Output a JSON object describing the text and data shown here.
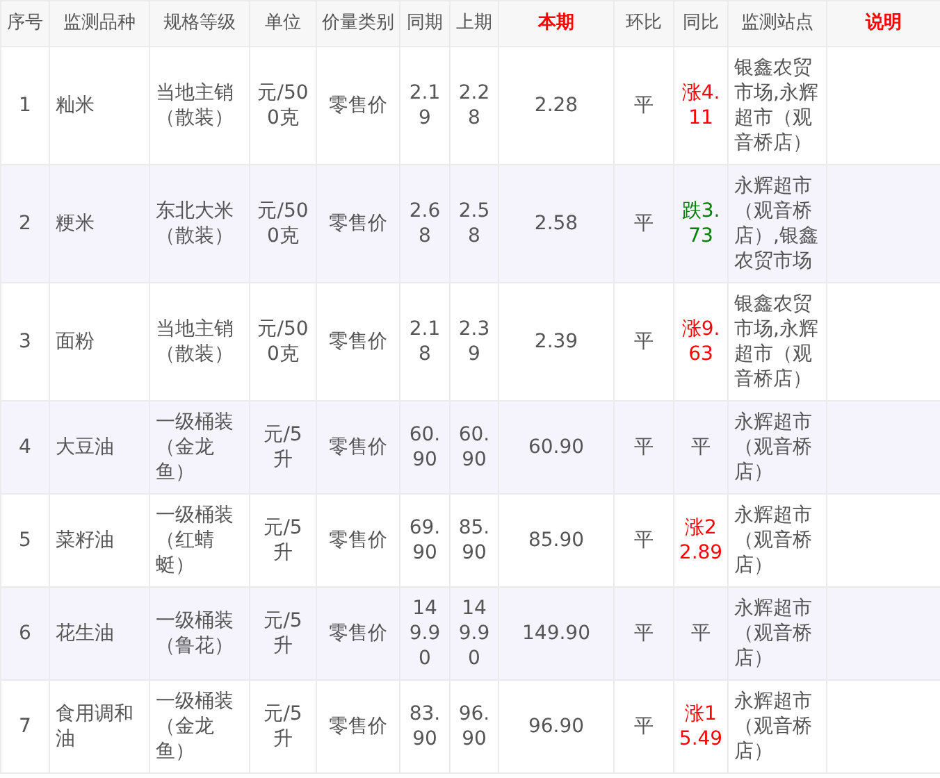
{
  "table": {
    "columns": [
      {
        "label": "序号",
        "highlight": false
      },
      {
        "label": "监测品种",
        "highlight": false
      },
      {
        "label": "规格等级",
        "highlight": false
      },
      {
        "label": "单位",
        "highlight": false
      },
      {
        "label": "价量类别",
        "highlight": false
      },
      {
        "label": "同期",
        "highlight": false
      },
      {
        "label": "上期",
        "highlight": false
      },
      {
        "label": "本期",
        "highlight": true
      },
      {
        "label": "环比",
        "highlight": false
      },
      {
        "label": "同比",
        "highlight": false
      },
      {
        "label": "监测站点",
        "highlight": false
      },
      {
        "label": "说明",
        "highlight": true
      }
    ],
    "rows": [
      {
        "no": "1",
        "item": "籼米",
        "spec": "当地主销（散装）",
        "unit": "元/500克",
        "price_type": "零售价",
        "same_period": "2.19",
        "last_period": "2.28",
        "current": "2.28",
        "mom": "平",
        "yoy": "涨4.11",
        "color": "#ff0000",
        "station": "银鑫农贸市场,永辉超市（观音桥店）"
      },
      {
        "no": "2",
        "item": "粳米",
        "spec": "东北大米（散装）",
        "unit": "元/500克",
        "price_type": "零售价",
        "same_period": "2.68",
        "last_period": "2.58",
        "current": "2.58",
        "mom": "平",
        "yoy": "跌3.73",
        "color": "#008000",
        "station": "永辉超市（观音桥店）,银鑫农贸市场"
      },
      {
        "no": "3",
        "item": "面粉",
        "spec": "当地主销（散装）",
        "unit": "元/500克",
        "price_type": "零售价",
        "same_period": "2.18",
        "last_period": "2.39",
        "current": "2.39",
        "mom": "平",
        "yoy": "涨9.63",
        "color": "#ff0000",
        "station": "银鑫农贸市场,永辉超市（观音桥店）"
      },
      {
        "no": "4",
        "item": "大豆油",
        "spec": "一级桶装（金龙鱼）",
        "unit": "元/5升",
        "price_type": "零售价",
        "same_period": "60.90",
        "last_period": "60.90",
        "current": "60.90",
        "mom": "平",
        "yoy": "平",
        "color": "#555555",
        "station": "永辉超市（观音桥店）"
      },
      {
        "no": "5",
        "item": "菜籽油",
        "spec": "一级桶装（红蜻蜓）",
        "unit": "元/5升",
        "price_type": "零售价",
        "same_period": "69.90",
        "last_period": "85.90",
        "current": "85.90",
        "mom": "平",
        "yoy": "涨22.89",
        "color": "#ff0000",
        "station": "永辉超市（观音桥店）"
      },
      {
        "no": "6",
        "item": "花生油",
        "spec": "一级桶装（鲁花）",
        "unit": "元/5升",
        "price_type": "零售价",
        "same_period": "149.90",
        "last_period": "149.90",
        "current": "149.90",
        "mom": "平",
        "yoy": "平",
        "color": "#555555",
        "station": "永辉超市（观音桥店）"
      },
      {
        "no": "7",
        "item": "食用调和油",
        "spec": "一级桶装（金龙鱼）",
        "unit": "元/5升",
        "price_type": "零售价",
        "same_period": "83.90",
        "last_period": "96.90",
        "current": "96.90",
        "mom": "平",
        "yoy": "涨15.49",
        "color": "#ff0000",
        "station": "永辉超市（观音桥店）"
      }
    ]
  }
}
